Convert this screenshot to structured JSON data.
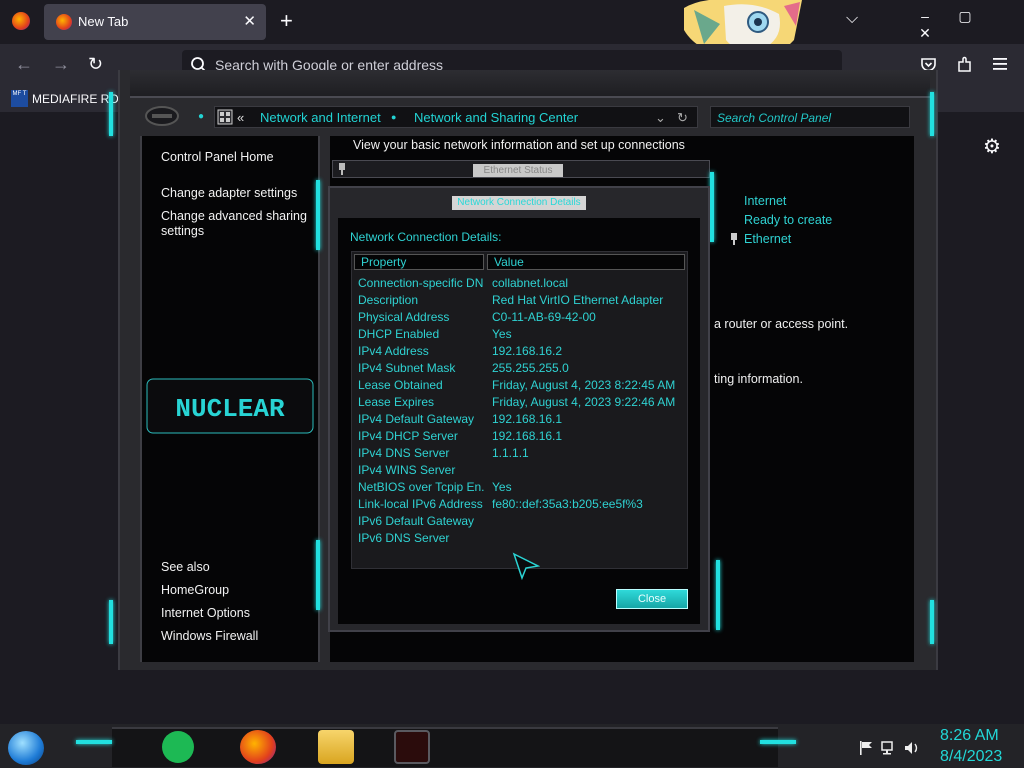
{
  "browser": {
    "tab": {
      "title": "New Tab",
      "close": "✕"
    },
    "new_tab": "+",
    "tab_list": "⌵",
    "window_controls": [
      "–",
      "▢",
      "✕"
    ],
    "nav": {
      "back": "←",
      "forward": "→",
      "reload": "↻"
    },
    "url_placeholder": "Search with Google or enter address",
    "toolbar_icons": [
      "pocket-icon",
      "extensions-icon",
      "menu-icon"
    ],
    "bookmark": {
      "icon_text": "MF T",
      "label": "MEDIAFIRE RO"
    },
    "settings_icon": "⚙"
  },
  "control_panel": {
    "breadcrumb": {
      "chevrons": "«",
      "segment1": "Network and Internet",
      "separator": "●",
      "segment2": "Network and Sharing Center",
      "dropdown": "⌄",
      "refresh": "↻"
    },
    "search_placeholder": "Search Control Panel",
    "sidebar": {
      "home": "Control Panel Home",
      "adapter": "Change adapter settings",
      "advanced": "Change advanced sharing settings",
      "see_also": "See also",
      "homegroup": "HomeGroup",
      "internet_options": "Internet Options",
      "firewall": "Windows Firewall"
    },
    "main": {
      "heading": "View your basic network information and set up connections",
      "internet": "Internet",
      "ready": "Ready to create",
      "ethernet": "Ethernet",
      "router_text": "a router or access point.",
      "info_text": "ting information."
    },
    "theme_logo": "NUCLEAR"
  },
  "ethernet_status": {
    "title": "Ethernet Status"
  },
  "details_dialog": {
    "title": "Network Connection Details",
    "label": "Network Connection Details:",
    "columns": [
      "Property",
      "Value"
    ],
    "rows": [
      {
        "property": "Connection-specific DN...",
        "value": "collabnet.local"
      },
      {
        "property": "Description",
        "value": "Red Hat VirtIO Ethernet Adapter"
      },
      {
        "property": "Physical Address",
        "value": "C0-11-AB-69-42-00"
      },
      {
        "property": "DHCP Enabled",
        "value": "Yes"
      },
      {
        "property": "IPv4 Address",
        "value": "192.168.16.2"
      },
      {
        "property": "IPv4 Subnet Mask",
        "value": "255.255.255.0"
      },
      {
        "property": "Lease Obtained",
        "value": "Friday, August 4, 2023 8:22:45 AM"
      },
      {
        "property": "Lease Expires",
        "value": "Friday, August 4, 2023 9:22:46 AM"
      },
      {
        "property": "IPv4 Default Gateway",
        "value": "192.168.16.1"
      },
      {
        "property": "IPv4 DHCP Server",
        "value": "192.168.16.1"
      },
      {
        "property": "IPv4 DNS Server",
        "value": "1.1.1.1"
      },
      {
        "property": "IPv4 WINS Server",
        "value": ""
      },
      {
        "property": "NetBIOS over Tcpip En...",
        "value": "Yes"
      },
      {
        "property": "Link-local IPv6 Address",
        "value": "fe80::def:35a3:b205:ee5f%3"
      },
      {
        "property": "IPv6 Default Gateway",
        "value": ""
      },
      {
        "property": "IPv6 DNS Server",
        "value": ""
      }
    ],
    "close_button": "Close"
  },
  "taskbar": {
    "time": "8:26 AM",
    "date": "8/4/2023",
    "tray_icons": [
      "flag-icon",
      "network-icon",
      "volume-icon"
    ]
  }
}
